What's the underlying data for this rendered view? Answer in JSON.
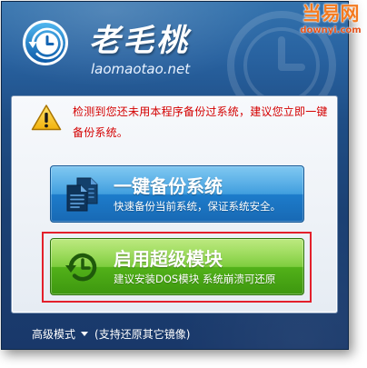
{
  "window": {
    "logo_icon": "clock-logo-icon",
    "brand_name": "老毛桃",
    "brand_domain": "laomaotao.net",
    "header_watermark_icon": "watermark-clock-icon"
  },
  "watermark": {
    "site_name": "当易网",
    "site_domain": "downyi.com",
    "color": "#f47b20"
  },
  "warning": {
    "icon": "warning-icon",
    "lines": [
      "检测到您还未用本程序备份过系统，建议您立即一键",
      "备份系统。"
    ],
    "color": "#d40000"
  },
  "actions": [
    {
      "icon": "document-copy-icon",
      "title": "一键备份系统",
      "subtitle": "快速备份当前系统，保证系统安全。",
      "color": "#2485d0"
    },
    {
      "icon": "restore-clock-icon",
      "title": "启用超级模块",
      "subtitle": "建议安装DOS模块 系统崩溃可还原",
      "color": "#5cb520",
      "highlighted": true,
      "highlight_color": "#e3202b"
    }
  ],
  "footer": {
    "advanced_mode_label": "高级模式",
    "toggle_icon": "chevron-down-icon",
    "advanced_mode_note": "(支持还原其它镜像)"
  }
}
